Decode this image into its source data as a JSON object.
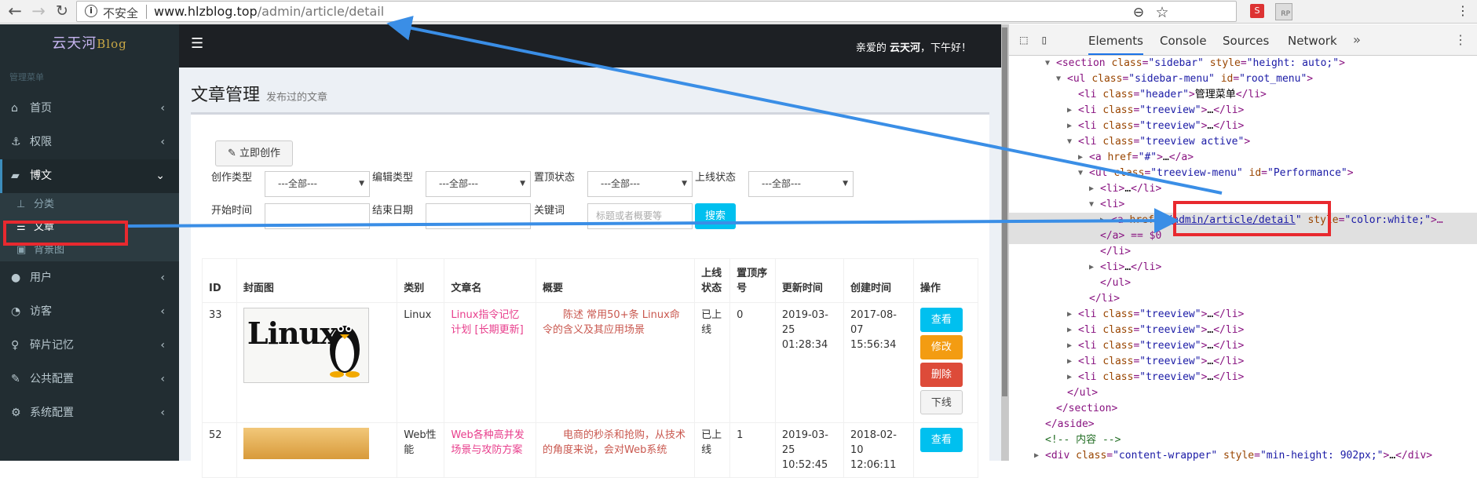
{
  "browser": {
    "security_label": "不安全",
    "url_host": "www.hlzblog.top",
    "url_path": "/admin/article/detail",
    "ext_label": "RP"
  },
  "sidebar": {
    "brand": "云天河",
    "brand_suffix": "Blog",
    "header": "管理菜单",
    "items": [
      {
        "label": "首页",
        "icon": "home-icon"
      },
      {
        "label": "权限",
        "icon": "anchor-icon"
      },
      {
        "label": "博文",
        "icon": "book-icon"
      },
      {
        "label": "用户",
        "icon": "user-icon"
      },
      {
        "label": "访客",
        "icon": "dashboard-icon"
      },
      {
        "label": "碎片记忆",
        "icon": "lightbulb-icon"
      },
      {
        "label": "公共配置",
        "icon": "wrench-icon"
      },
      {
        "label": "系统配置",
        "icon": "gear-icon"
      }
    ],
    "sub_items": [
      {
        "label": "分类",
        "icon": "thumbtack-icon"
      },
      {
        "label": "文章",
        "icon": "list-icon"
      },
      {
        "label": "背景图",
        "icon": "image-icon"
      }
    ]
  },
  "topbar": {
    "greet_pre": "亲爱的 ",
    "greet_name": "云天河",
    "greet_post": "，下午好！"
  },
  "page": {
    "title": "文章管理",
    "subtitle": "发布过的文章"
  },
  "filters": {
    "create_button": "立即创作",
    "type_label": "创作类型",
    "edit_label": "编辑类型",
    "top_label": "置顶状态",
    "online_label": "上线状态",
    "all_option": "---全部---",
    "start_label": "开始时间",
    "end_label": "结束日期",
    "keyword_label": "关键词",
    "keyword_placeholder": "标题或者概要等",
    "search_button": "搜索"
  },
  "table": {
    "headers": [
      "ID",
      "封面图",
      "类别",
      "文章名",
      "概要",
      "上线状态",
      "置顶序号",
      "更新时间",
      "创建时间",
      "操作"
    ],
    "rows": [
      {
        "id": "33",
        "cover_text": "Linux",
        "category": "Linux",
        "title": "Linux指令记忆计划 [长期更新]",
        "summary": "陈述 常用50+条 Linux命令的含义及其应用场景",
        "status": "已上线",
        "top": "0",
        "updated": "2019-03-25 01:28:34",
        "created": "2017-08-07 15:56:34"
      },
      {
        "id": "52",
        "category": "Web性能",
        "title": "Web各种高并发场景与攻防方案",
        "summary": "电商的秒杀和抢购，从技术的角度来说，会对Web系统",
        "status": "已上线",
        "top": "1",
        "updated": "2019-03-25 10:52:45",
        "created": "2018-02-10 12:06:11"
      }
    ],
    "actions": {
      "view": "查看",
      "edit": "修改",
      "delete": "删除",
      "offline": "下线"
    }
  },
  "devtools": {
    "tabs": [
      "Elements",
      "Console",
      "Sources",
      "Network"
    ],
    "lines": [
      "<section class=\"sidebar\" style=\"height: auto;\">",
      "<ul class=\"sidebar-menu\" id=\"root_menu\">",
      "<li class=\"header\">管理菜单</li>",
      "<li class=\"treeview\">…</li>",
      "<li class=\"treeview\">…</li>",
      "<li class=\"treeview active\">",
      "<a href=\"#\">…</a>",
      "<ul class=\"treeview-menu\" id=\"Performance\">",
      "<li>…</li>",
      "<li>",
      "<a href=\"/admin/article/detail\" style=\"color:white;\">…",
      "</a> == $0",
      "</li>",
      "<li>…</li>",
      "</ul>",
      "</li>",
      "<li class=\"treeview\">…</li>",
      "<li class=\"treeview\">…</li>",
      "<li class=\"treeview\">…</li>",
      "<li class=\"treeview\">…</li>",
      "<li class=\"treeview\">…</li>",
      "</ul>",
      "</section>",
      "</aside>",
      "<!-- 内容 -->",
      "<div class=\"content-wrapper\" style=\"min-height: 902px;\">…</div>"
    ]
  }
}
